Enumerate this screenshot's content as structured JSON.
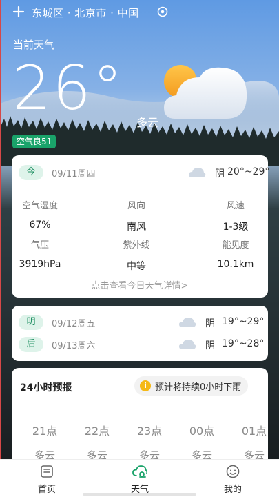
{
  "header": {
    "location": "东城区 · 北京市 · 中国",
    "icons": [
      "plus-icon",
      "location-pin-icon"
    ]
  },
  "current": {
    "label": "当前天气",
    "temperature": "26°",
    "condition": "多云",
    "aqi": "空气良51",
    "weather_icon": "sun-behind-cloud-icon"
  },
  "today": {
    "chip": "今",
    "date": "09/11周四",
    "condition": "阴",
    "range": "20°~29°",
    "metrics": [
      {
        "label": "空气湿度",
        "value": "67%"
      },
      {
        "label": "风向",
        "value": "南风"
      },
      {
        "label": "风速",
        "value": "1-3级"
      },
      {
        "label": "气压",
        "value": "3919hPa"
      },
      {
        "label": "紫外线",
        "value": "中等"
      },
      {
        "label": "能见度",
        "value": "10.1km"
      }
    ],
    "detail_link": "点击查看今日天气详情>"
  },
  "forecast": [
    {
      "chip": "明",
      "date": "09/12周五",
      "condition": "阴",
      "range": "19°~29°"
    },
    {
      "chip": "后",
      "date": "09/13周六",
      "condition": "阴",
      "range": "19°~28°"
    }
  ],
  "hourly": {
    "title": "24小时预报",
    "rain_notice": "预计将持续0小时下雨",
    "rain_icon_char": "i",
    "hours": [
      {
        "time": "21点",
        "condition": "多云"
      },
      {
        "time": "22点",
        "condition": "多云"
      },
      {
        "time": "23点",
        "condition": "多云"
      },
      {
        "time": "00点",
        "condition": "多云"
      },
      {
        "time": "01点",
        "condition": "多云"
      }
    ]
  },
  "nav": {
    "items": [
      {
        "label": "首页",
        "icon": "home-icon"
      },
      {
        "label": "天气",
        "icon": "weather-icon"
      },
      {
        "label": "我的",
        "icon": "profile-icon"
      }
    ],
    "active": "天气"
  },
  "colors": {
    "accent": "#1aa36a",
    "aqi_badge": "#1aa36a",
    "chip_bg": "#def3ea",
    "sky_top": "#6aa1e4"
  }
}
